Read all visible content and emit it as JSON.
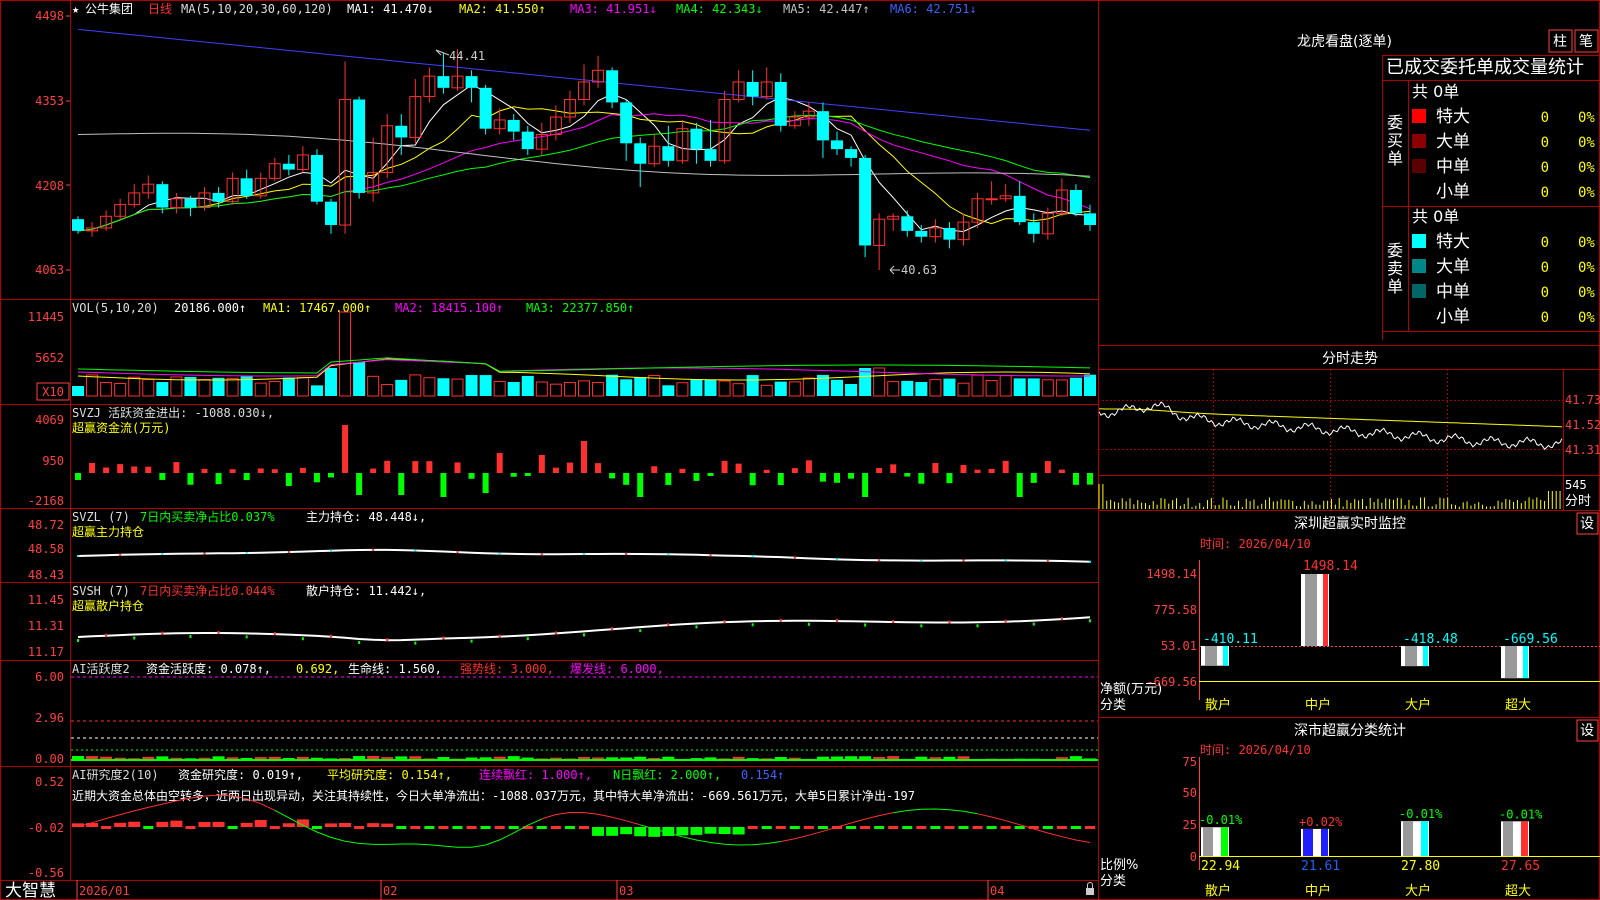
{
  "colors": {
    "up": "#ff3030",
    "down": "#00ffff",
    "ma1": "#ffffff",
    "ma2": "#ffff00",
    "ma3": "#ff00ff",
    "ma4": "#00ff00",
    "ma5": "#c0c0c0",
    "ma6": "#4040ff",
    "grid": "#a00000",
    "axis": "#ff4040",
    "green": "#00ff00",
    "yellow": "#ffff00",
    "blue": "#4060ff"
  },
  "main_header": {
    "star": "★",
    "stock": "公牛集团",
    "period": "日线",
    "ma_params": "MA(5,10,20,30,60,120)",
    "ma1": "MA1: 41.470↓",
    "ma2": "MA2: 41.550↑",
    "ma3": "MA3: 41.951↓",
    "ma4": "MA4: 42.343↓",
    "ma5": "MA5: 42.447↑",
    "ma6": "MA6: 42.751↓"
  },
  "price_axis": [
    "4498",
    "4353",
    "4208",
    "4063"
  ],
  "annotations": {
    "high": "44.41",
    "low": "40.63"
  },
  "vol_header": {
    "name": "VOL(5,10,20)",
    "value": "20186.000↑",
    "ma1": "MA1: 17467.000↑",
    "ma2": "MA2: 18415.100↑",
    "ma3": "MA3: 22377.850↑"
  },
  "vol_axis": [
    "11445",
    "5652"
  ],
  "vol_unit": "X10",
  "svzj": {
    "header": "SVZJ  活跃资金进出: -1088.030↓,",
    "subtitle": "超赢资金流(万元)",
    "axis": [
      "4069",
      "950",
      "-2168"
    ]
  },
  "svzl": {
    "name": "SVZL (7)",
    "ratio": "7日内买卖净占比0.037%",
    "hold": "主力持仓: 48.448↓,",
    "subtitle": "超赢主力持仓",
    "axis": [
      "48.72",
      "48.58",
      "48.43"
    ]
  },
  "svsh": {
    "name": "SVSH (7)",
    "ratio": "7日内买卖净占比0.044%",
    "hold": "散户持仓: 11.442↓,",
    "subtitle": "超赢散户持仓",
    "axis": [
      "11.45",
      "11.31",
      "11.17"
    ]
  },
  "ai_active": {
    "name": "AI活跃度2",
    "fund": "资金活跃度: 0.078↑,",
    "v2": "0.692,",
    "life": "生命线: 1.560,",
    "strong": "强势线: 3.000,",
    "burst": "爆发线: 6.000,",
    "axis": [
      "6.00",
      "2.96",
      "0.00"
    ]
  },
  "ai_research": {
    "name": "AI研究度2(10)",
    "fund": "资金研究度: 0.019↑,",
    "avg": "平均研究度: 0.154↑,",
    "red": "连续飘红: 1.000↑,",
    "nred": "N日飘红: 2.000↑,",
    "last": "0.154↑",
    "comment": "近期大资金总体由空转多，近两日出现异动，关注其持续性，今日大单净流出：-1088.037万元，其中特大单净流出：-669.561万元，大单5日累计净出-197",
    "axis": [
      "0.52",
      "-0.02",
      "-0.56"
    ]
  },
  "x_axis": [
    "2026/01",
    "02",
    "03",
    "04"
  ],
  "brand": "大智慧",
  "chart_data": {
    "type": "candlestick",
    "title": "公牛集团 日线",
    "ylim": [
      40.63,
      44.98
    ],
    "candles": [
      [
        41.5,
        41.3,
        41.55,
        41.25
      ],
      [
        41.3,
        41.35,
        41.45,
        41.2
      ],
      [
        41.35,
        41.55,
        41.65,
        41.3
      ],
      [
        41.55,
        41.75,
        41.85,
        41.5
      ],
      [
        41.75,
        41.95,
        42.1,
        41.7
      ],
      [
        41.95,
        42.1,
        42.25,
        41.85
      ],
      [
        42.1,
        41.7,
        42.15,
        41.6
      ],
      [
        41.7,
        41.85,
        41.95,
        41.6
      ],
      [
        41.85,
        41.7,
        41.9,
        41.55
      ],
      [
        41.7,
        41.95,
        42.05,
        41.65
      ],
      [
        41.95,
        41.8,
        42.05,
        41.7
      ],
      [
        41.8,
        42.2,
        42.3,
        41.75
      ],
      [
        42.2,
        41.9,
        42.35,
        41.85
      ],
      [
        41.9,
        42.2,
        42.3,
        41.85
      ],
      [
        42.2,
        42.45,
        42.55,
        42.15
      ],
      [
        42.45,
        42.35,
        42.6,
        42.25
      ],
      [
        42.35,
        42.6,
        42.75,
        42.3
      ],
      [
        42.6,
        41.8,
        42.7,
        41.75
      ],
      [
        41.8,
        41.4,
        41.85,
        41.25
      ],
      [
        41.4,
        43.55,
        44.2,
        41.25
      ],
      [
        43.55,
        41.95,
        43.6,
        41.85
      ],
      [
        41.95,
        42.3,
        42.9,
        41.8
      ],
      [
        42.3,
        43.1,
        43.3,
        42.2
      ],
      [
        43.1,
        42.9,
        43.3,
        42.6
      ],
      [
        42.9,
        43.6,
        43.9,
        42.8
      ],
      [
        43.6,
        43.95,
        44.1,
        43.5
      ],
      [
        43.95,
        43.75,
        44.35,
        43.65
      ],
      [
        43.75,
        43.95,
        44.41,
        43.7
      ],
      [
        43.95,
        43.75,
        44.05,
        43.5
      ],
      [
        43.75,
        43.05,
        43.8,
        42.95
      ],
      [
        43.05,
        43.2,
        43.4,
        42.95
      ],
      [
        43.2,
        43.0,
        43.3,
        42.85
      ],
      [
        43.0,
        42.7,
        43.1,
        42.6
      ],
      [
        42.7,
        42.95,
        43.15,
        42.6
      ],
      [
        42.95,
        43.25,
        43.45,
        42.85
      ],
      [
        43.25,
        43.55,
        43.7,
        43.15
      ],
      [
        43.55,
        43.85,
        44.15,
        43.45
      ],
      [
        43.85,
        44.05,
        44.3,
        43.75
      ],
      [
        44.05,
        43.5,
        44.1,
        43.4
      ],
      [
        43.5,
        42.8,
        43.55,
        42.5
      ],
      [
        42.8,
        42.45,
        42.9,
        42.05
      ],
      [
        42.45,
        42.75,
        42.95,
        42.4
      ],
      [
        42.75,
        42.5,
        43.1,
        42.4
      ],
      [
        42.5,
        43.05,
        43.2,
        42.45
      ],
      [
        43.05,
        42.7,
        43.15,
        42.45
      ],
      [
        42.7,
        42.5,
        43.2,
        42.4
      ],
      [
        42.5,
        43.55,
        43.7,
        42.45
      ],
      [
        43.55,
        43.85,
        44.05,
        43.5
      ],
      [
        43.85,
        43.6,
        44.05,
        43.45
      ],
      [
        43.6,
        43.85,
        44.1,
        43.55
      ],
      [
        43.85,
        43.1,
        44.0,
        43.0
      ],
      [
        43.1,
        43.25,
        43.35,
        43.05
      ],
      [
        43.25,
        43.35,
        43.5,
        43.1
      ],
      [
        43.35,
        42.85,
        43.5,
        42.55
      ],
      [
        42.85,
        42.7,
        43.0,
        42.6
      ],
      [
        42.7,
        42.55,
        42.75,
        42.4
      ],
      [
        42.55,
        41.05,
        42.6,
        40.85
      ],
      [
        41.05,
        41.5,
        41.6,
        40.63
      ],
      [
        41.5,
        41.55,
        41.6,
        41.3
      ],
      [
        41.55,
        41.3,
        41.65,
        41.2
      ],
      [
        41.3,
        41.2,
        41.4,
        41.1
      ],
      [
        41.2,
        41.35,
        41.5,
        41.1
      ],
      [
        41.35,
        41.15,
        41.45,
        41.0
      ],
      [
        41.15,
        41.45,
        41.6,
        41.05
      ],
      [
        41.45,
        41.85,
        41.95,
        41.35
      ],
      [
        41.85,
        41.85,
        42.15,
        41.75
      ],
      [
        41.85,
        41.9,
        42.1,
        41.8
      ],
      [
        41.9,
        41.45,
        42.15,
        41.4
      ],
      [
        41.45,
        41.25,
        41.6,
        41.1
      ],
      [
        41.25,
        41.6,
        41.7,
        41.15
      ],
      [
        41.6,
        42.0,
        42.2,
        41.55
      ],
      [
        42.0,
        41.6,
        42.1,
        41.55
      ],
      [
        41.6,
        41.4,
        41.75,
        41.3
      ]
    ]
  },
  "right": {
    "dragon_title": "龙虎看盘(逐单)",
    "btn_zhu": "柱",
    "btn_bi": "笔",
    "stats_title": "已成交委托单成交量统计",
    "buy_label": "委买单",
    "sell_label": "委卖单",
    "buy_total": "共 0单",
    "sell_total": "共 0单",
    "buy_rows": [
      {
        "name": "特大",
        "count": "0",
        "pct": "0%",
        "color": "#ff0000"
      },
      {
        "name": "大单",
        "count": "0",
        "pct": "0%",
        "color": "#8b0000"
      },
      {
        "name": "中单",
        "count": "0",
        "pct": "0%",
        "color": "#5a0000"
      },
      {
        "name": "小单",
        "count": "0",
        "pct": "0%",
        "color": ""
      }
    ],
    "sell_rows": [
      {
        "name": "特大",
        "count": "0",
        "pct": "0%",
        "color": "#00ffff"
      },
      {
        "name": "大单",
        "count": "0",
        "pct": "0%",
        "color": "#008888"
      },
      {
        "name": "中单",
        "count": "0",
        "pct": "0%",
        "color": "#006666"
      },
      {
        "name": "小单",
        "count": "0",
        "pct": "0%",
        "color": ""
      }
    ],
    "intraday_title": "分时走势",
    "intraday_axis": [
      "41.73",
      "41.52",
      "41.31"
    ],
    "intraday_vol": "545",
    "intraday_label": "分时",
    "sz_title": "深圳超赢实时监控",
    "sz_btn": "设",
    "sz_time": "时间: 2026/04/10",
    "sz_axis": [
      "1498.14",
      "775.58",
      "53.01",
      "-669.56"
    ],
    "sz_ylabel": "净额(万元)",
    "sz_xlabel": "分类",
    "sz_cats": [
      "散户",
      "中户",
      "大户",
      "超大"
    ],
    "sz_values": [
      -410.11,
      1498.14,
      -418.48,
      -669.56
    ],
    "sz_labels": [
      "-410.11",
      "1498.14",
      "-418.48",
      "-669.56"
    ],
    "sm_title": "深市超赢分类统计",
    "sm_btn": "设",
    "sm_time": "时间: 2026/04/10",
    "sm_axis": [
      "75",
      "50",
      "25",
      "0"
    ],
    "sm_ylabel": "比例%",
    "sm_xlabel": "分类",
    "sm_cats": [
      "散户",
      "中户",
      "大户",
      "超大"
    ],
    "sm_values": [
      22.94,
      21.61,
      27.8,
      27.65
    ],
    "sm_labels": [
      "22.94",
      "21.61",
      "27.80",
      "27.65"
    ],
    "sm_changes": [
      "-0.01%",
      "+0.02%",
      "-0.01%",
      "-0.01%"
    ]
  }
}
